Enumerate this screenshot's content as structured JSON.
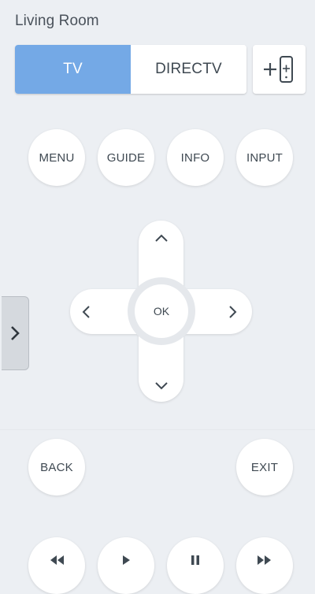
{
  "room": {
    "title": "Living Room"
  },
  "device_toggle": {
    "tabs": [
      {
        "label": "TV",
        "active": true
      },
      {
        "label": "DIRECTV",
        "active": false
      }
    ],
    "add_icon": "add-device-icon"
  },
  "buttons": {
    "menu": "MENU",
    "guide": "GUIDE",
    "info": "INFO",
    "input": "INPUT",
    "ok": "OK",
    "back": "BACK",
    "exit": "EXIT"
  },
  "dpad_icons": [
    "chevron-up-icon",
    "chevron-left-icon",
    "chevron-right-icon",
    "chevron-down-icon"
  ],
  "side_tab_icon": "chevron-right-icon",
  "transport_icons": [
    "rewind-icon",
    "play-icon",
    "pause-icon",
    "fast-forward-icon"
  ],
  "colors": {
    "accent": "#74a9e6",
    "background": "#eceff3",
    "button": "#ffffff",
    "text": "#3f4952"
  }
}
